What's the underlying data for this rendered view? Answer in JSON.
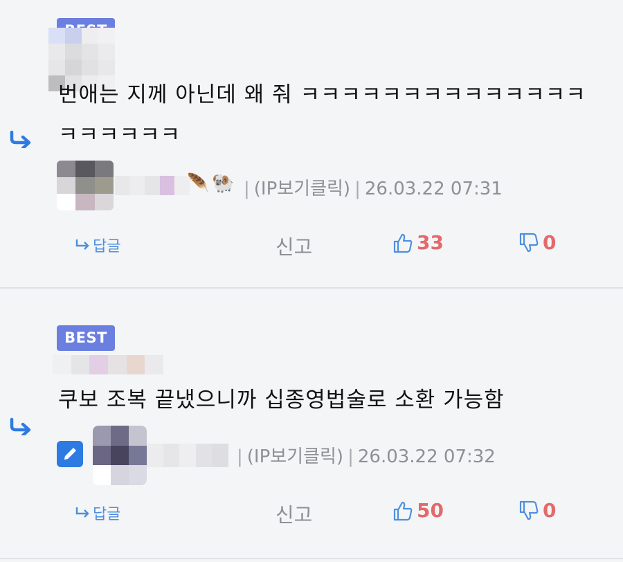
{
  "comments": [
    {
      "badge": "BEST",
      "text": "번애는 지께 아닌데 왜 줘 ㅋㅋㅋㅋㅋㅋㅋㅋㅋㅋㅋㅋㅋㅋㅋㅋㅋㅋㅋㅋ",
      "author_emoji_1": "🪶",
      "author_emoji_2": "🐏",
      "ip_label": "(IP보기클릭)",
      "separator": "|",
      "timestamp": "26.03.22 07:31",
      "reply_label": "답글",
      "report_label": "신고",
      "likes": "33",
      "dislikes": "0"
    },
    {
      "badge": "BEST",
      "text": "쿠보 조복 끝냈으니까 십종영법술로 소환 가능함",
      "ip_label": "(IP보기클릭)",
      "separator": "|",
      "timestamp": "26.03.22 07:32",
      "reply_label": "답글",
      "report_label": "신고",
      "likes": "50",
      "dislikes": "0"
    }
  ],
  "colors": {
    "background": "#f4f5f7",
    "badge": "#6b7fe0",
    "reply_accent": "#2d7be2",
    "count": "#e36a6a",
    "meta_text": "#8d9096"
  },
  "icons": {
    "reply_arrow": "reply-arrow-icon",
    "thumbs_up": "thumbs-up-icon",
    "thumbs_down": "thumbs-down-icon",
    "edit": "pencil-icon"
  }
}
